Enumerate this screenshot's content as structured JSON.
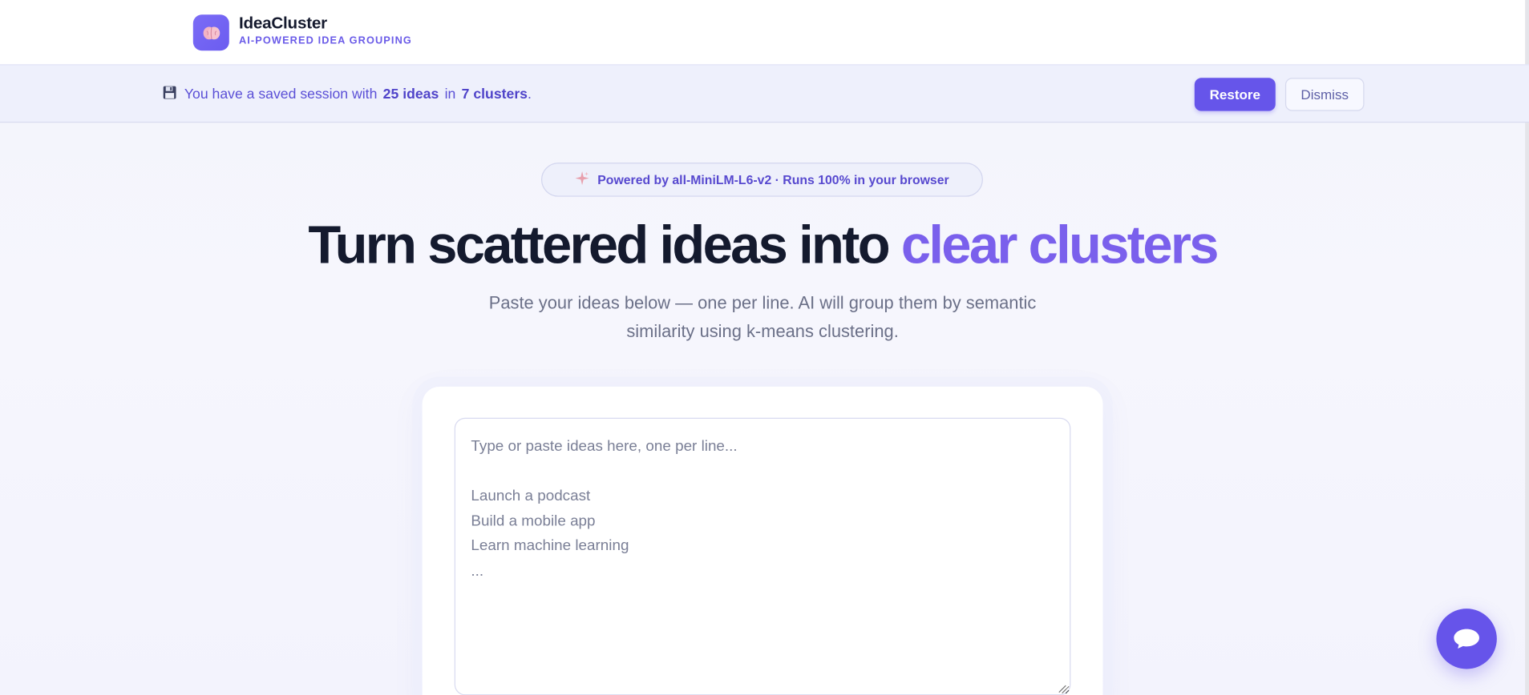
{
  "header": {
    "brand_name": "IdeaCluster",
    "brand_tagline": "AI-POWERED IDEA GROUPING",
    "logo_icon": "brain-icon"
  },
  "session_banner": {
    "icon": "floppy-disk-icon",
    "text_prefix": "You have a saved session with",
    "ideas_count": "25 ideas",
    "text_middle": "in",
    "clusters_count": "7 clusters",
    "text_suffix": ".",
    "restore_label": "Restore",
    "dismiss_label": "Dismiss"
  },
  "hero": {
    "pill_icon": "sparkle-icon",
    "pill_text": "Powered by all-MiniLM-L6-v2 · Runs 100% in your browser",
    "title_main": "Turn scattered ideas into ",
    "title_accent": "clear clusters",
    "subtitle": "Paste your ideas below — one per line. AI will group them by semantic similarity using k-means clustering."
  },
  "input": {
    "placeholder": "Type or paste ideas here, one per line...\n\nLaunch a podcast\nBuild a mobile app\nLearn machine learning\n...",
    "value": ""
  },
  "chat": {
    "icon": "chat-bubble-icon"
  },
  "colors": {
    "accent": "#6655ea",
    "accent_text": "#7a60ec",
    "banner_bg": "#eef0fc",
    "title": "#141a2e"
  }
}
